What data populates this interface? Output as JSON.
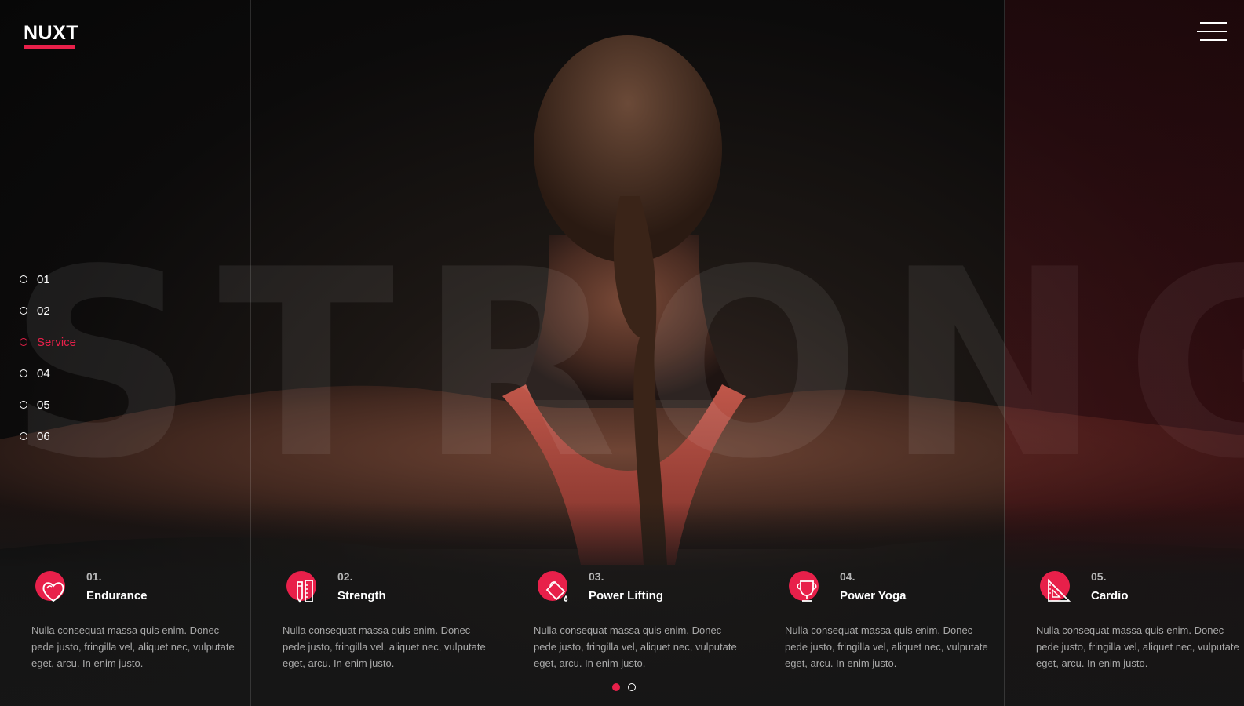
{
  "brand": {
    "logo": "NUXT",
    "accent": "#e8204a"
  },
  "header": {
    "menu_icon": "hamburger-menu-icon"
  },
  "hero": {
    "background_word": "STRONG"
  },
  "sidenav": {
    "items": [
      {
        "label": "01",
        "active": false
      },
      {
        "label": "02",
        "active": false
      },
      {
        "label": "Service",
        "active": true
      },
      {
        "label": "04",
        "active": false
      },
      {
        "label": "05",
        "active": false
      },
      {
        "label": "06",
        "active": false
      }
    ]
  },
  "services": [
    {
      "num": "01.",
      "title": "Endurance",
      "icon": "heart-icon",
      "desc": "Nulla consequat massa quis enim. Donec pede justo, fringilla vel, aliquet nec, vulputate eget, arcu. In enim justo."
    },
    {
      "num": "02.",
      "title": "Strength",
      "icon": "pencil-ruler-icon",
      "desc": "Nulla consequat massa quis enim. Donec pede justo, fringilla vel, aliquet nec, vulputate eget, arcu. In enim justo."
    },
    {
      "num": "03.",
      "title": "Power Lifting",
      "icon": "paint-bucket-icon",
      "desc": "Nulla consequat massa quis enim. Donec pede justo, fringilla vel, aliquet nec, vulputate eget, arcu. In enim justo."
    },
    {
      "num": "04.",
      "title": "Power Yoga",
      "icon": "trophy-icon",
      "desc": "Nulla consequat massa quis enim. Donec pede justo, fringilla vel, aliquet nec, vulputate eget, arcu. In enim justo."
    },
    {
      "num": "05.",
      "title": "Cardio",
      "icon": "set-square-icon",
      "desc": "Nulla consequat massa quis enim. Donec pede justo, fringilla vel, aliquet nec, vulputate eget, arcu. In enim justo."
    }
  ],
  "pagination": {
    "pages": 2,
    "current": 1
  }
}
